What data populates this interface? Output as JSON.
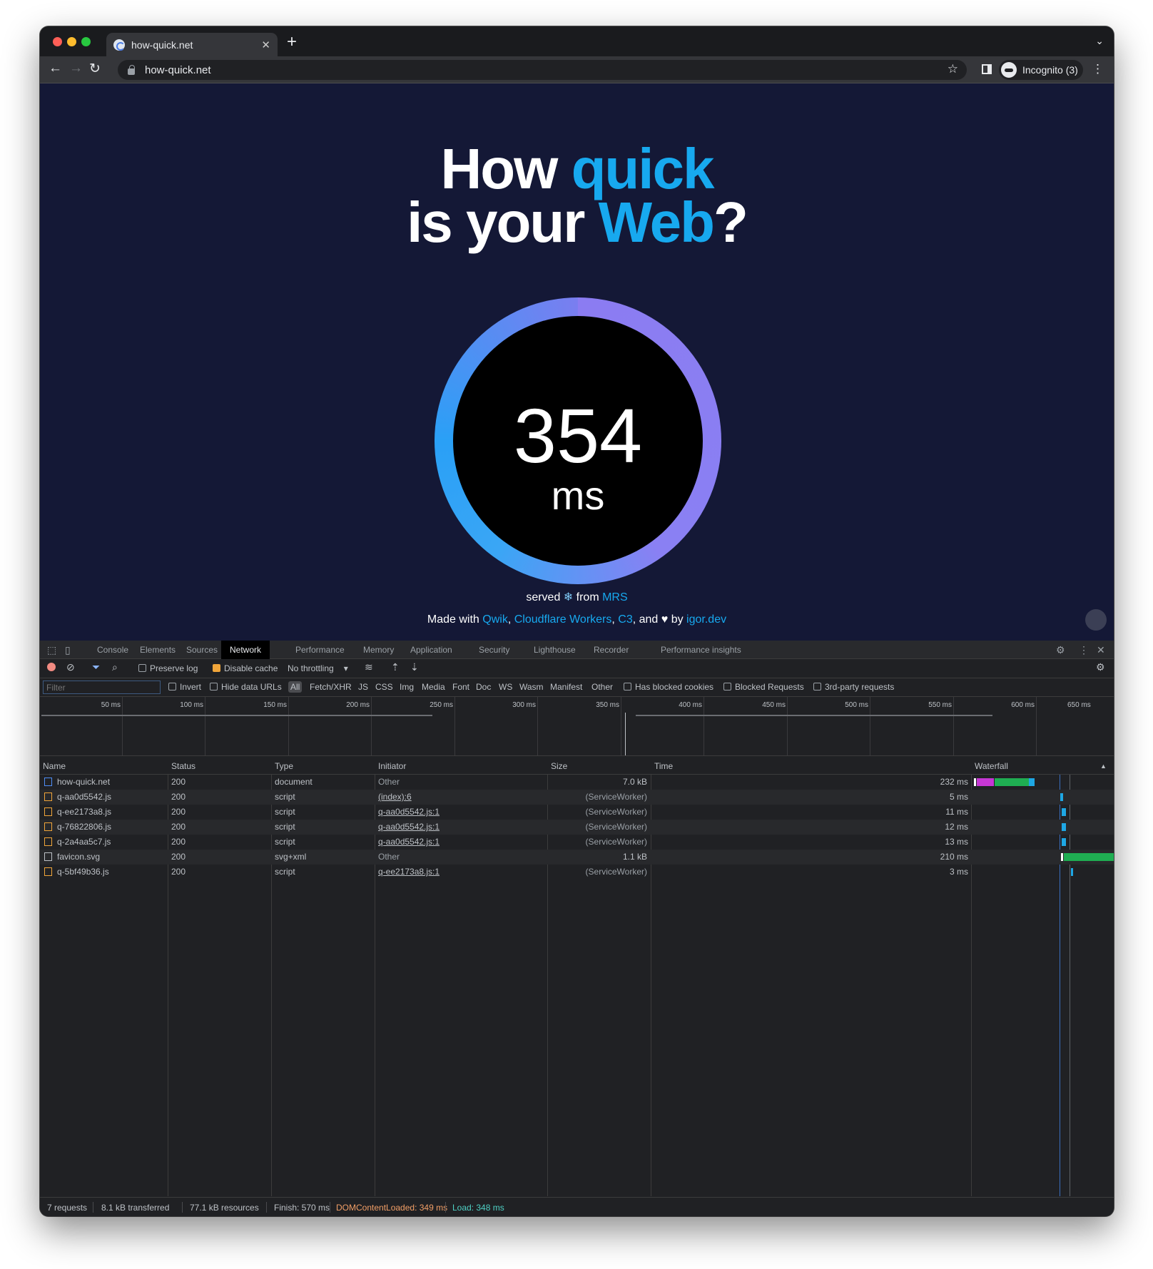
{
  "browser": {
    "tab_title": "how-quick.net",
    "url": "how-quick.net",
    "profile_label": "Incognito (3)"
  },
  "page": {
    "heading_line1_a": "How ",
    "heading_line1_b": "quick",
    "heading_line2_a": "is your ",
    "heading_line2_b": "Web",
    "heading_line2_c": "?",
    "metric_value": "354",
    "metric_unit": "ms",
    "served_prefix": "served ",
    "served_mid": " from ",
    "served_location": "MRS",
    "made_prefix": "Made with ",
    "made_link1": "Qwik",
    "made_sep1": ", ",
    "made_link2": "Cloudflare Workers",
    "made_sep2": ", ",
    "made_link3": "C3",
    "made_sep3": ", and ",
    "made_by": " by ",
    "made_link4": "igor.dev",
    "colors": {
      "bg": "#141836",
      "accent": "#17a9ef",
      "ring_start": "#8b7cf2",
      "ring_end": "#2aa0f6"
    }
  },
  "devtools": {
    "tabs": [
      "Console",
      "Elements",
      "Sources",
      "Network",
      "Performance",
      "Memory",
      "Application",
      "Security",
      "Lighthouse",
      "Recorder",
      "Performance insights"
    ],
    "active_tab": "Network",
    "toolbar": {
      "preserve_log": "Preserve log",
      "disable_cache": "Disable cache",
      "throttling": "No throttling"
    },
    "filter": {
      "placeholder": "Filter",
      "invert": "Invert",
      "hide_data_urls": "Hide data URLs",
      "types": [
        "All",
        "Fetch/XHR",
        "JS",
        "CSS",
        "Img",
        "Media",
        "Font",
        "Doc",
        "WS",
        "Wasm",
        "Manifest",
        "Other"
      ],
      "has_blocked_cookies": "Has blocked cookies",
      "blocked_requests": "Blocked Requests",
      "third_party": "3rd-party requests"
    },
    "overview_ticks": [
      "50 ms",
      "100 ms",
      "150 ms",
      "200 ms",
      "250 ms",
      "300 ms",
      "350 ms",
      "400 ms",
      "450 ms",
      "500 ms",
      "550 ms",
      "600 ms",
      "650 ms"
    ],
    "columns": {
      "name": "Name",
      "status": "Status",
      "type": "Type",
      "initiator": "Initiator",
      "size": "Size",
      "time": "Time",
      "waterfall": "Waterfall"
    },
    "rows": [
      {
        "name": "how-quick.net",
        "status": "200",
        "type": "document",
        "initiator": "Other",
        "size": "7.0 kB",
        "time": "232 ms",
        "kind": "doc"
      },
      {
        "name": "q-aa0d5542.js",
        "status": "200",
        "type": "script",
        "initiator": "(index):6",
        "size": "(ServiceWorker)",
        "time": "5 ms",
        "kind": "js"
      },
      {
        "name": "q-ee2173a8.js",
        "status": "200",
        "type": "script",
        "initiator": "q-aa0d5542.js:1",
        "size": "(ServiceWorker)",
        "time": "11 ms",
        "kind": "js"
      },
      {
        "name": "q-76822806.js",
        "status": "200",
        "type": "script",
        "initiator": "q-aa0d5542.js:1",
        "size": "(ServiceWorker)",
        "time": "12 ms",
        "kind": "js"
      },
      {
        "name": "q-2a4aa5c7.js",
        "status": "200",
        "type": "script",
        "initiator": "q-aa0d5542.js:1",
        "size": "(ServiceWorker)",
        "time": "13 ms",
        "kind": "js"
      },
      {
        "name": "favicon.svg",
        "status": "200",
        "type": "svg+xml",
        "initiator": "Other",
        "size": "1.1 kB",
        "time": "210 ms",
        "kind": "svg"
      },
      {
        "name": "q-5bf49b36.js",
        "status": "200",
        "type": "script",
        "initiator": "q-ee2173a8.js:1",
        "size": "(ServiceWorker)",
        "time": "3 ms",
        "kind": "js"
      }
    ],
    "summary": {
      "requests": "7 requests",
      "transferred": "8.1 kB transferred",
      "resources": "77.1 kB resources",
      "finish": "Finish: 570 ms",
      "dom_content_loaded": "DOMContentLoaded: 349 ms",
      "load": "Load: 348 ms"
    }
  }
}
